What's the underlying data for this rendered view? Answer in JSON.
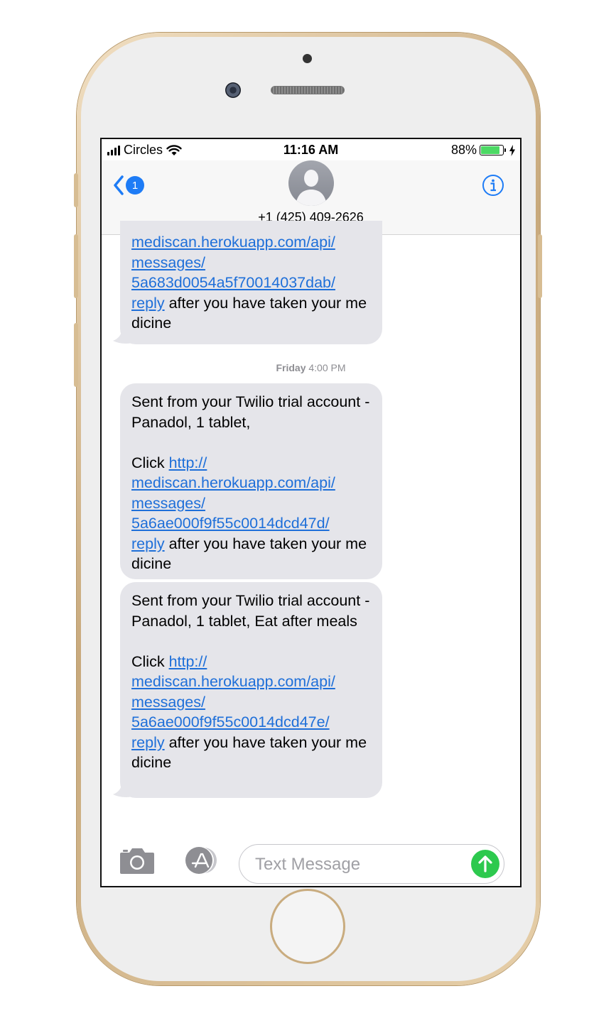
{
  "status": {
    "carrier": "Circles",
    "time": "11:16 AM",
    "battery": "88%",
    "battery_level": 0.88,
    "battery_color": "#4cd964"
  },
  "nav": {
    "back_badge": "1",
    "contact": "+1 (425) 409-2626",
    "accent": "#1e7cf6"
  },
  "messages": [
    {
      "pre": "",
      "links": [
        "mediscan.herokuapp.com/api/",
        "messages/",
        "5a683d0054a5f70014037dab/",
        "reply"
      ],
      "post": " after you have taken your medicine"
    },
    {
      "pre": "Sent from your Twilio trial account - Panadol, 1 tablet,\n\nClick ",
      "links": [
        "http://",
        "mediscan.herokuapp.com/api/",
        "messages/",
        "5a6ae000f9f55c0014dcd47d/",
        "reply"
      ],
      "post": " after you have taken your medicine"
    },
    {
      "pre": "Sent from your Twilio trial account - Panadol, 1 tablet, Eat after meals\n\nClick ",
      "links": [
        "http://",
        "mediscan.herokuapp.com/api/",
        "messages/",
        "5a6ae000f9f55c0014dcd47e/",
        "reply"
      ],
      "post": " after you have taken your medicine"
    }
  ],
  "timestamp": {
    "day": "Friday",
    "time": "4:00 PM"
  },
  "composer": {
    "placeholder": "Text Message",
    "send_color": "#2dc94e"
  },
  "icons": [
    "signal-icon",
    "wifi-icon",
    "battery-icon",
    "charging-icon",
    "back-chevron-icon",
    "avatar-icon",
    "info-icon",
    "camera-icon",
    "app-store-icon",
    "send-arrow-icon"
  ]
}
